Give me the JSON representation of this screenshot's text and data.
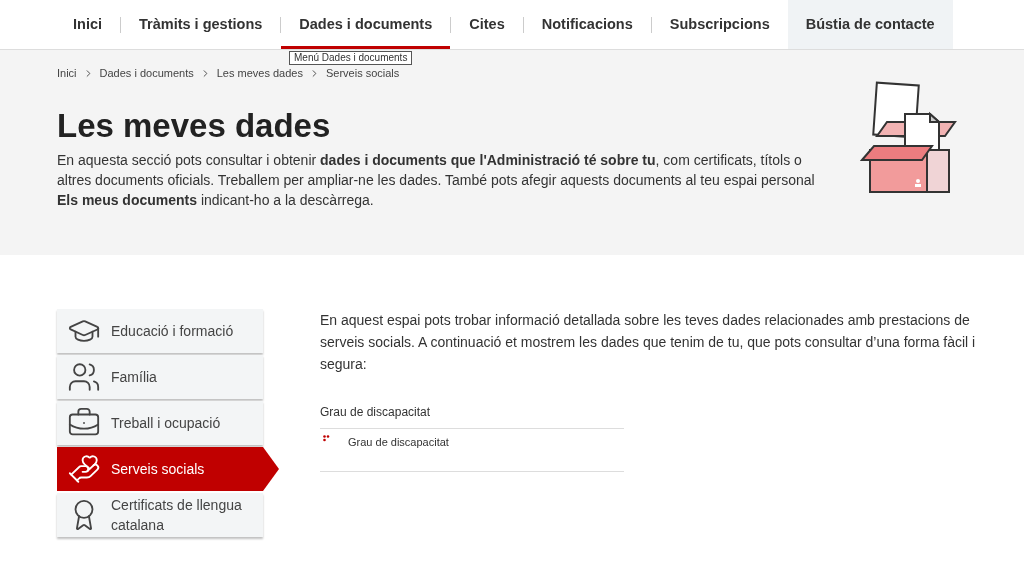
{
  "nav": [
    {
      "label": "Inici",
      "selected": false,
      "highlighted": false
    },
    {
      "label": "Tràmits i gestions",
      "selected": false,
      "highlighted": false
    },
    {
      "label": "Dades i documents",
      "selected": true,
      "highlighted": false
    },
    {
      "label": "Cites",
      "selected": false,
      "highlighted": false
    },
    {
      "label": "Notificacions",
      "selected": false,
      "highlighted": false
    },
    {
      "label": "Subscripcions",
      "selected": false,
      "highlighted": false
    },
    {
      "label": "Bústia de contacte",
      "selected": false,
      "highlighted": true
    }
  ],
  "tooltip": "Menú Dades i documents",
  "breadcrumb": [
    "Inici",
    "Dades i documents",
    "Les meves dades",
    "Serveis socials"
  ],
  "header": {
    "title": "Les meves dades",
    "text": "En aquesta secció pots consultar i obtenir **dades i documents que l'Administració té sobre tu**, com certificats, títols o altres documents oficials. Treballem per ampliar-ne les dades. També pots afegir aquests documents al teu espai personal **Els meus documents** indicant-ho a la descàrrega."
  },
  "sidebar": [
    {
      "label": "Educació i formació",
      "selected": false
    },
    {
      "label": "Família",
      "selected": false
    },
    {
      "label": "Treball i ocupació",
      "selected": false
    },
    {
      "label": "Serveis socials",
      "selected": true
    },
    {
      "label": "Certificats de llengua catalana",
      "selected": false
    }
  ],
  "content": {
    "intro": "En aquest espai pots trobar informació detallada sobre les teves dades relacionades amb prestacions de serveis socials. A continuació et mostrem les dades que tenim de tu, que pots consultar d’una forma fàcil i segura:",
    "section_title": "Grau de discapacitat",
    "items": [
      "Grau de discapacitat"
    ]
  }
}
